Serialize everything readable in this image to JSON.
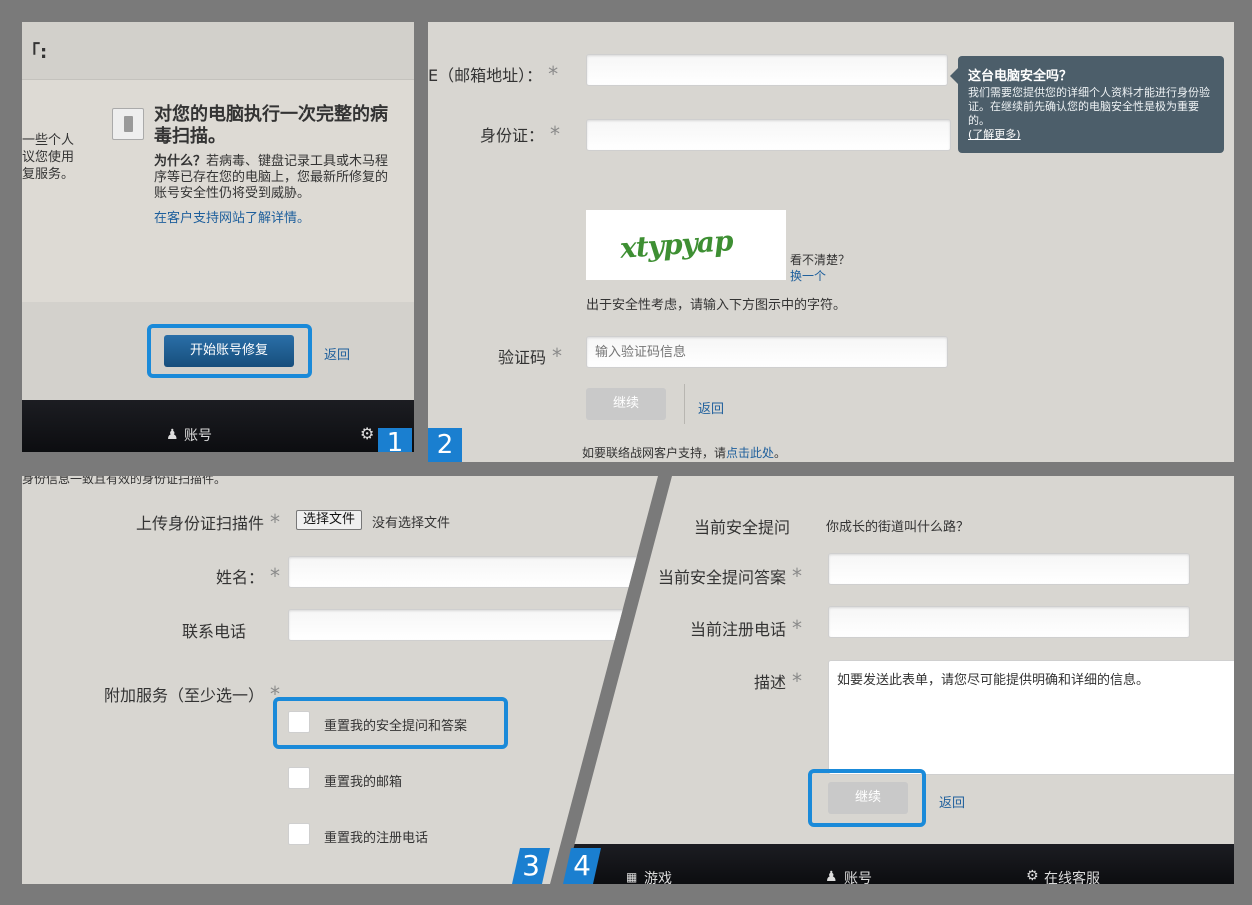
{
  "panel1": {
    "title_fragment": "「:",
    "left_text": [
      "一些个人",
      "议您使用",
      "复服务。"
    ],
    "heading": "对您的电脑执行一次完整的病毒扫描。",
    "why_label": "为什么？",
    "why_text": "若病毒、键盘记录工具或木马程序等已存在您的电脑上，您最新所修复的账号安全性仍将受到威胁。",
    "support_link": "在客户支持网站了解详情。",
    "start_button": "开始账号修复",
    "back_link": "返回",
    "nav_account": "账号",
    "badge": "1"
  },
  "panel2": {
    "email_label": "E（邮箱地址）：",
    "id_label": "身份证：",
    "tooltip_title": "这台电脑安全吗？",
    "tooltip_text": "我们需要您提供您的详细个人资料才能进行身份验证。在继续前先确认您的电脑安全性是极为重要的。",
    "tooltip_link": "(了解更多)",
    "captcha_text": "xtypyap",
    "unclear": "看不清楚？",
    "refresh": "换一个",
    "security_note": "出于安全性考虑，请输入下方图示中的字符。",
    "code_label": "验证码",
    "code_placeholder": "输入验证码信息",
    "continue_button": "继续",
    "back_link": "返回",
    "contact_prefix": "如要联络战网客户支持，请",
    "contact_link": "点击此处",
    "contact_suffix": "。",
    "badge": "2"
  },
  "panel3": {
    "top_text": "身份信息一致且有效的身份证扫描件。",
    "upload_label": "上传身份证扫描件",
    "choose_file": "选择文件",
    "no_file": "没有选择文件",
    "name_label": "姓名：",
    "phone_label": "联系电话",
    "services_label": "附加服务（至少选一）",
    "options": [
      "重置我的安全提问和答案",
      "重置我的邮箱",
      "重置我的注册电话"
    ],
    "badge": "3"
  },
  "panel4": {
    "question_label": "当前安全提问",
    "question_value": "你成长的街道叫什么路？",
    "answer_label": "当前安全提问答案",
    "reg_phone_label": "当前注册电话",
    "desc_label": "描述",
    "desc_placeholder": "如要发送此表单，请您尽可能提供明确和详细的信息。",
    "continue_button": "继续",
    "back_link": "返回",
    "nav": [
      "游戏",
      "账号",
      "在线客服"
    ],
    "badge": "4"
  },
  "colors": {
    "accent_blue": "#1a8ad9",
    "link_blue": "#1e5f9c",
    "tooltip_bg": "#4c5e6a",
    "primary_button": "#1d5f93"
  }
}
